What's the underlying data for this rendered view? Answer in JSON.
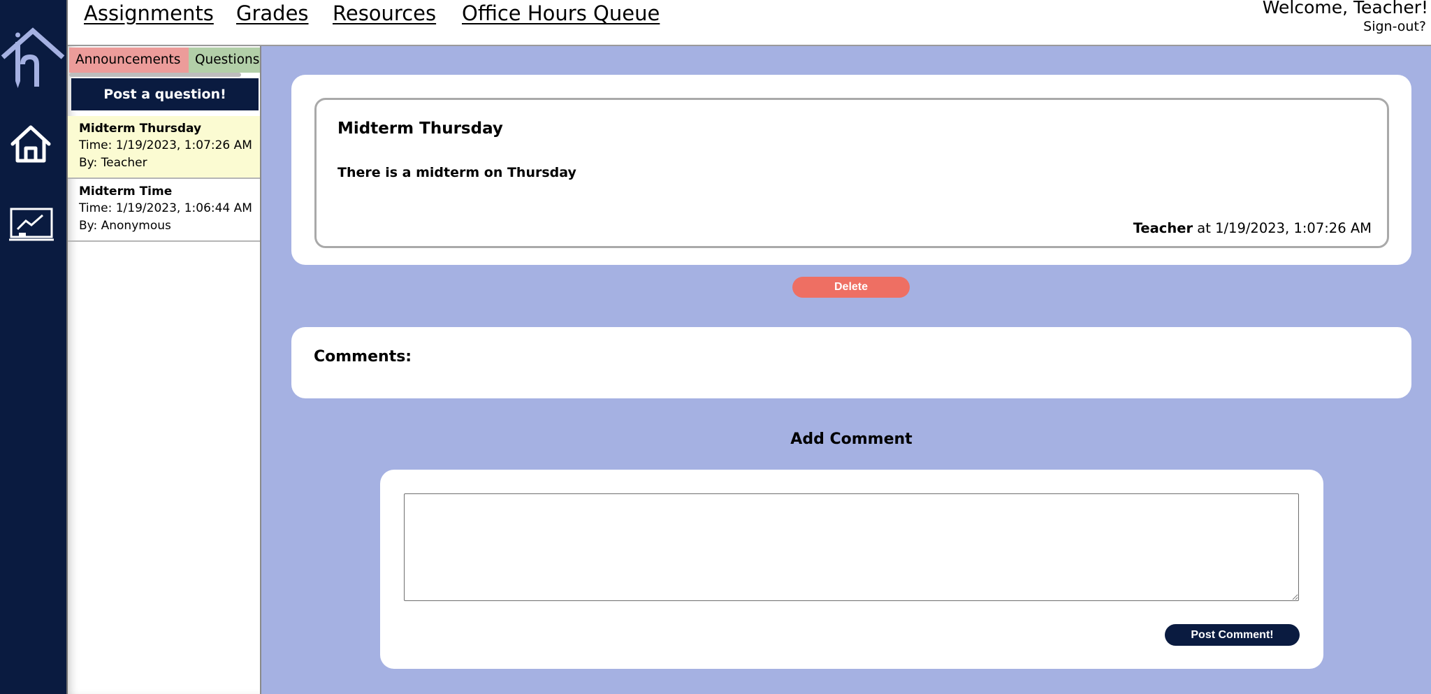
{
  "nav": {
    "links": [
      "Assignments",
      "Grades",
      "Resources",
      "Office Hours Queue"
    ],
    "welcome": "Welcome, Teacher!",
    "signout": "Sign-out?"
  },
  "rail": {
    "icons": [
      "logo-icon",
      "home-icon",
      "classroom-board-icon"
    ]
  },
  "sidebar": {
    "tabs": [
      "Announcements",
      "Questions"
    ],
    "post_button": "Post a question!",
    "items": [
      {
        "title": "Midterm Thursday",
        "time": "Time: 1/19/2023, 1:07:26 AM",
        "by": "By: Teacher"
      },
      {
        "title": "Midterm Time",
        "time": "Time: 1/19/2023, 1:06:44 AM",
        "by": "By: Anonymous"
      }
    ]
  },
  "post": {
    "title": "Midterm Thursday",
    "body": "There is a midterm on Thursday",
    "author": "Teacher",
    "timestamp": " at 1/19/2023, 1:07:26 AM",
    "delete_label": "Delete"
  },
  "comments": {
    "label": "Comments:",
    "add_heading": "Add Comment",
    "textarea_value": "",
    "post_label": "Post Comment!"
  },
  "colors": {
    "navy": "#0a1b40",
    "background": "#a5b1e2",
    "announcements_tab": "#ec9c9a",
    "questions_tab": "#b2cfa8",
    "active_item": "#fbfbd2",
    "delete": "#ee6f63"
  }
}
